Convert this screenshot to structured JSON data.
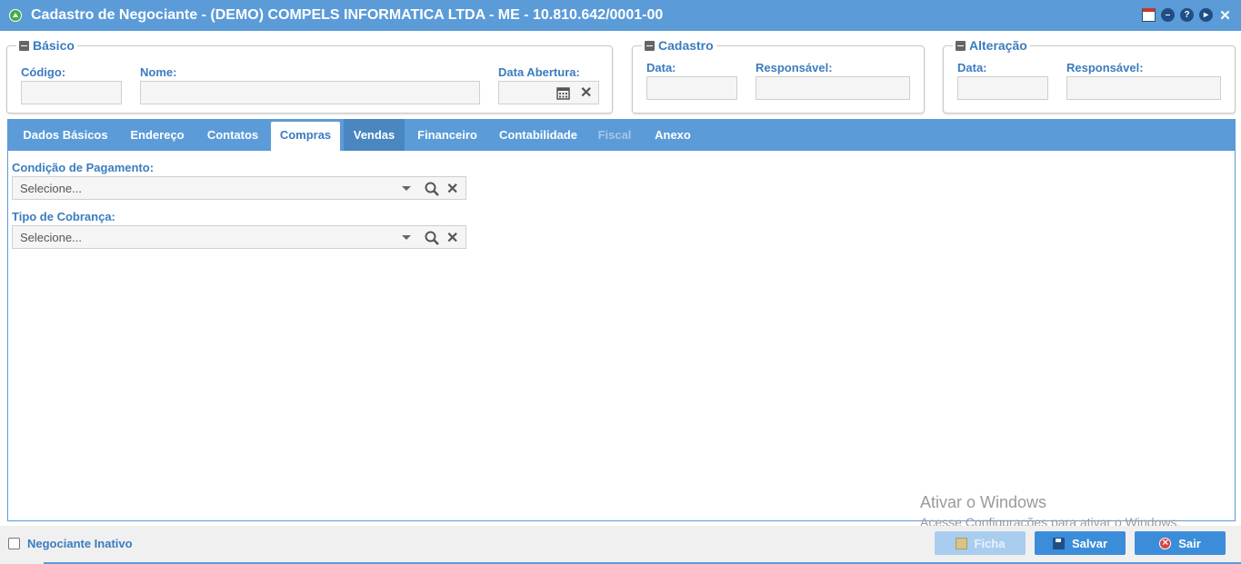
{
  "window": {
    "title": "Cadastro de Negociante - (DEMO) COMPELS INFORMATICA LTDA - ME - 10.810.642/0001-00",
    "toolbar_icons": [
      "calendar-icon",
      "minimize-icon",
      "help-icon",
      "next-icon",
      "close-icon"
    ],
    "help_glyph": "?"
  },
  "basico": {
    "legend": "Básico",
    "codigo_label": "Código:",
    "nome_label": "Nome:",
    "data_abertura_label": "Data Abertura:",
    "codigo_value": "",
    "nome_value": "",
    "data_abertura_value": ""
  },
  "cadastro": {
    "legend": "Cadastro",
    "data_label": "Data:",
    "responsavel_label": "Responsável:"
  },
  "alteracao": {
    "legend": "Alteração",
    "data_label": "Data:",
    "responsavel_label": "Responsável:"
  },
  "tabs": [
    {
      "label": "Dados Básicos",
      "state": "normal"
    },
    {
      "label": "Endereço",
      "state": "normal"
    },
    {
      "label": "Contatos",
      "state": "normal"
    },
    {
      "label": "Compras",
      "state": "active"
    },
    {
      "label": "Vendas",
      "state": "hover"
    },
    {
      "label": "Financeiro",
      "state": "normal"
    },
    {
      "label": "Contabilidade",
      "state": "normal"
    },
    {
      "label": "Fiscal",
      "state": "disabled"
    },
    {
      "label": "Anexo",
      "state": "normal"
    }
  ],
  "compras": {
    "condicao_label": "Condição de Pagamento:",
    "condicao_placeholder": "Selecione...",
    "tipo_label": "Tipo de Cobrança:",
    "tipo_placeholder": "Selecione..."
  },
  "footer": {
    "inativo_label": "Negociante Inativo",
    "inativo_checked": false,
    "ficha_label": "Ficha",
    "salvar_label": "Salvar",
    "sair_label": "Sair"
  },
  "watermark": {
    "line1": "Ativar o Windows",
    "line2": "Acesse Configurações para ativar o Windows."
  },
  "colors": {
    "accent": "#5b9bd8",
    "label": "#3a7cc0",
    "button": "#3c8dd9"
  }
}
